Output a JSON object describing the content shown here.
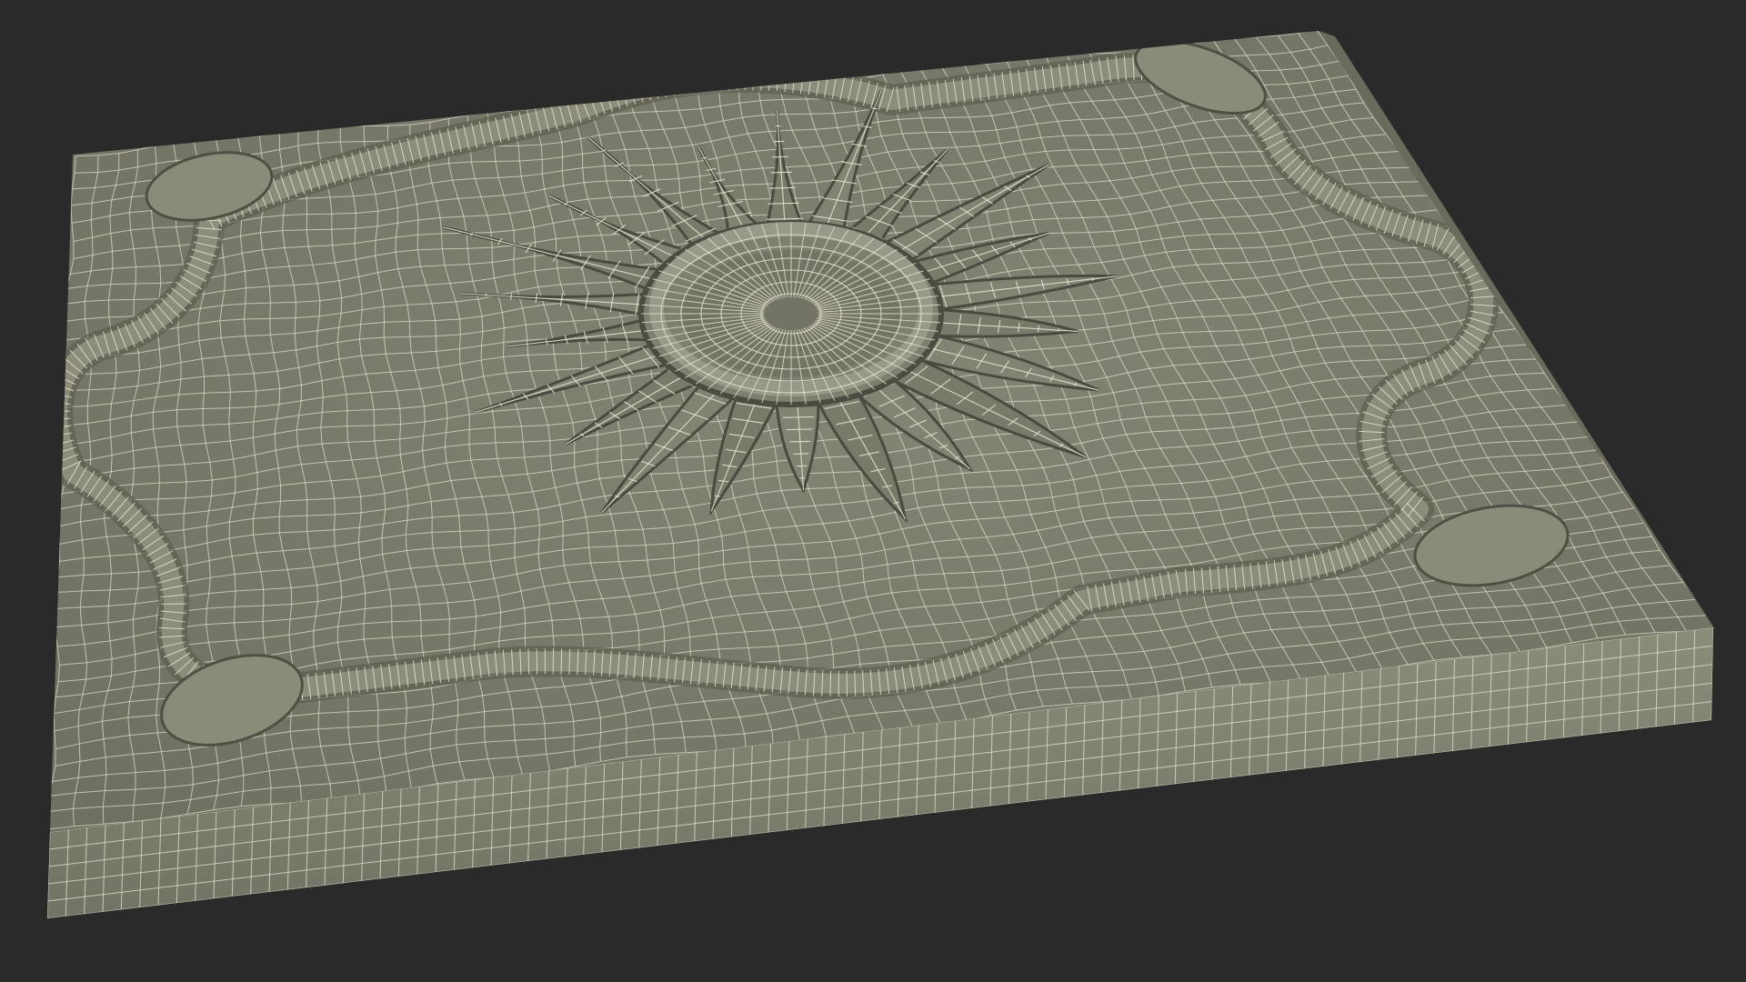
{
  "scene": {
    "subject": "wireframe-tile-model",
    "background_color": "#2a2a2a",
    "surface_color": "#7b7b6c",
    "surface_dark_color": "#5f5f52",
    "side_color": "#8a8a79",
    "wire_color": "#e6e3cf",
    "shadow_color": "#3f3f36"
  }
}
